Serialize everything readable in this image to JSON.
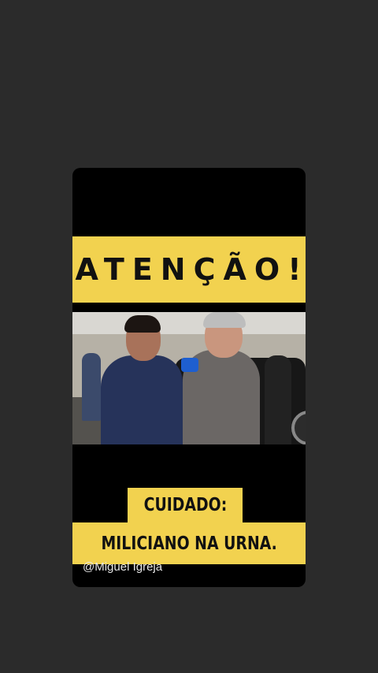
{
  "story": {
    "banner_text": "ATENÇÃO!",
    "caption_line1": "CUIDADO:",
    "caption_line2": "MILICIANO NA URNA.",
    "handle": "@Miguel Igreja"
  },
  "colors": {
    "background": "#2b2b2b",
    "accent_yellow": "#f2d24f",
    "card": "#000000"
  }
}
